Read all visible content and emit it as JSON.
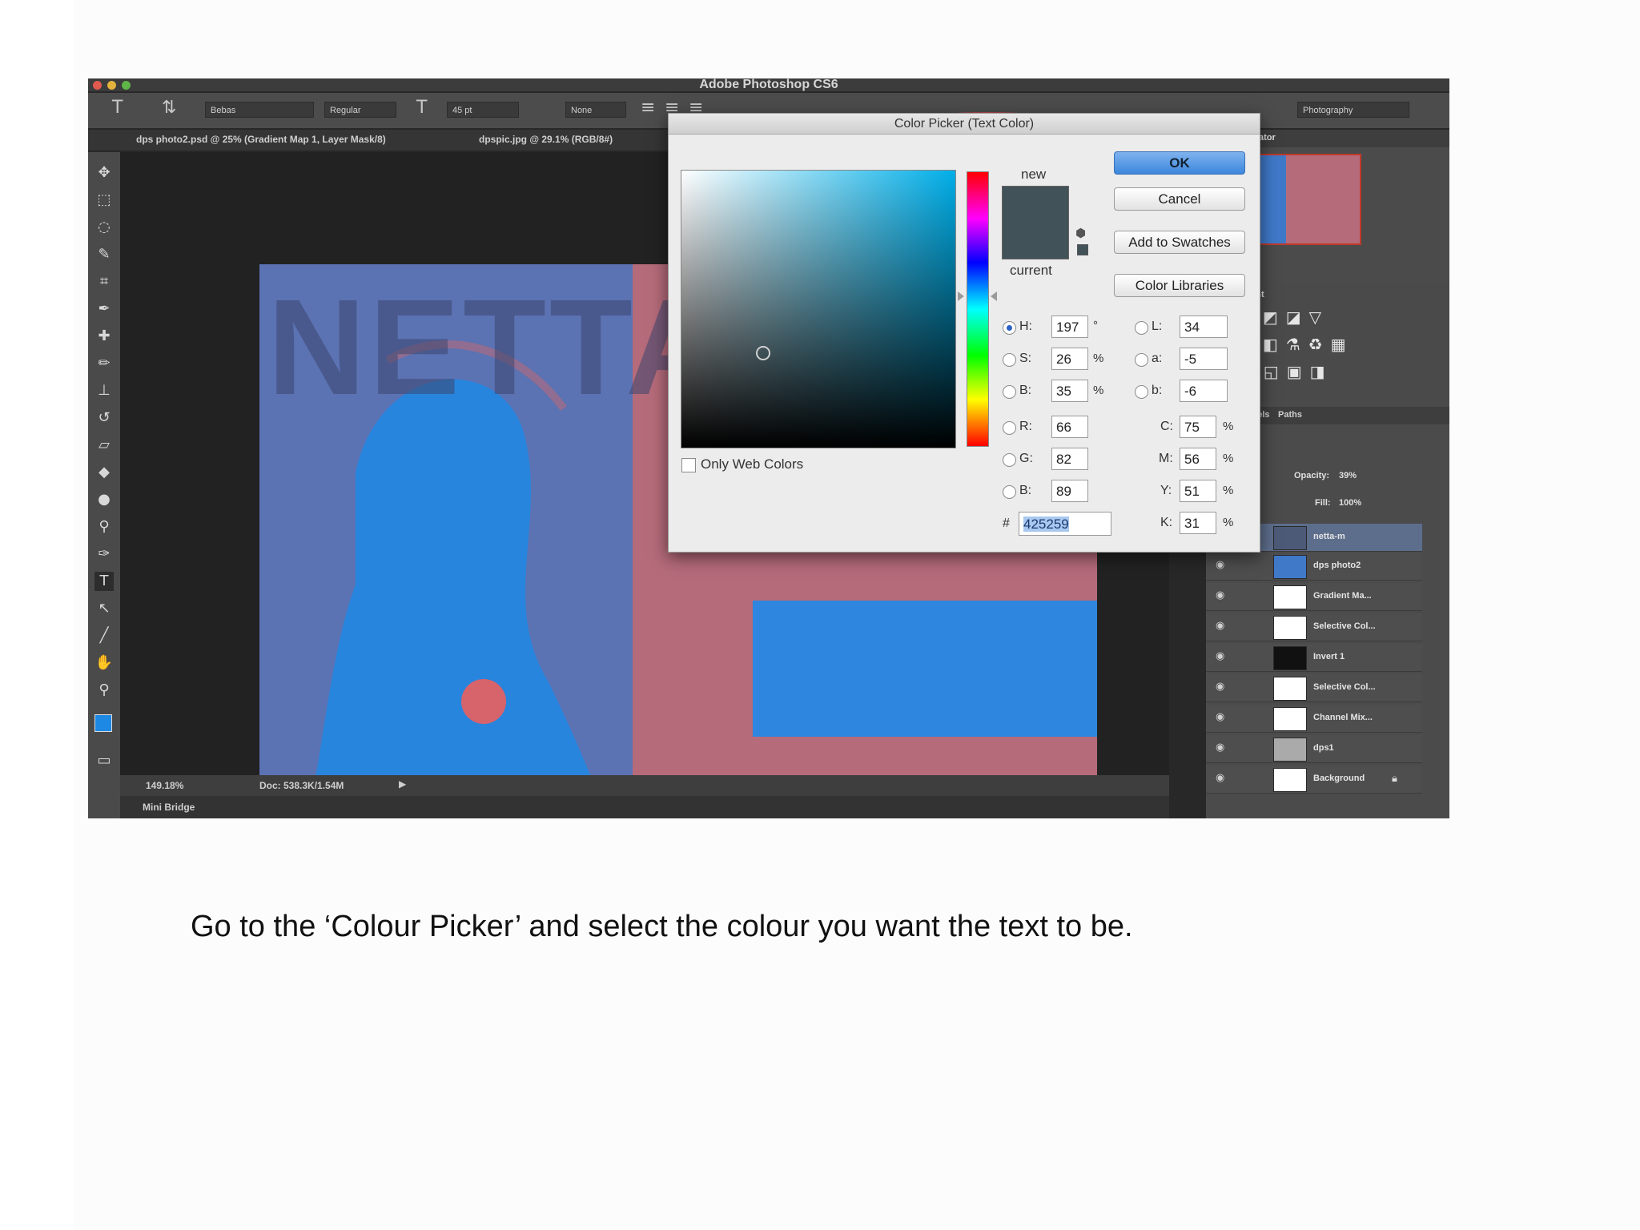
{
  "app": {
    "title": "Adobe Photoshop CS6"
  },
  "options_bar": {
    "font": "Bebas",
    "style": "Regular",
    "size": "45 pt",
    "anti_alias": "None",
    "workspace": "Photography"
  },
  "tabs": [
    "dps photo2.psd @ 25% (Gradient Map 1, Layer Mask/8)",
    "dpspic.jpg @ 29.1% (RGB/8#)"
  ],
  "canvas": {
    "watermark_text": "NETTA"
  },
  "status": {
    "zoom": "149.18%",
    "doc": "Doc: 538.3K/1.54M"
  },
  "mini_bridge": "Mini Bridge",
  "panels": {
    "navigator_tab": "Navigator",
    "adjustments_label": "adjustment",
    "channels_tab": "Channels",
    "paths_tab": "Paths",
    "opacity_label": "Opacity:",
    "opacity_value": "39%",
    "fill_label": "Fill:",
    "fill_value": "100%",
    "layers": [
      "netta-m",
      "dps photo2",
      "Gradient Ma...",
      "Selective Col...",
      "Invert 1",
      "Selective Col...",
      "Channel Mix...",
      "dps1",
      "Background"
    ]
  },
  "color_picker": {
    "title": "Color Picker (Text Color)",
    "new_label": "new",
    "current_label": "current",
    "new_color": "#425259",
    "current_color": "#425259",
    "buttons": {
      "ok": "OK",
      "cancel": "Cancel",
      "add_swatches": "Add to Swatches",
      "color_libraries": "Color Libraries"
    },
    "only_web_colors": "Only Web Colors",
    "hsb": {
      "h_label": "H:",
      "h": "197",
      "h_unit": "°",
      "s_label": "S:",
      "s": "26",
      "s_unit": "%",
      "b_label": "B:",
      "b": "35",
      "b_unit": "%"
    },
    "rgb": {
      "r_label": "R:",
      "r": "66",
      "g_label": "G:",
      "g": "82",
      "b_label": "B:",
      "b": "89"
    },
    "lab": {
      "l_label": "L:",
      "l": "34",
      "a_label": "a:",
      "a": "-5",
      "b_label": "b:",
      "b": "-6"
    },
    "cmyk": {
      "c_label": "C:",
      "c": "75",
      "m_label": "M:",
      "m": "56",
      "y_label": "Y:",
      "y": "51",
      "k_label": "K:",
      "k": "31",
      "unit": "%"
    },
    "hex_label": "#",
    "hex": "425259"
  },
  "caption": "Go to the ‘Colour Picker’ and select the colour you want the text to be.",
  "colors": {
    "callout": "#b8474c",
    "accent_blue": "#3c86dc"
  }
}
